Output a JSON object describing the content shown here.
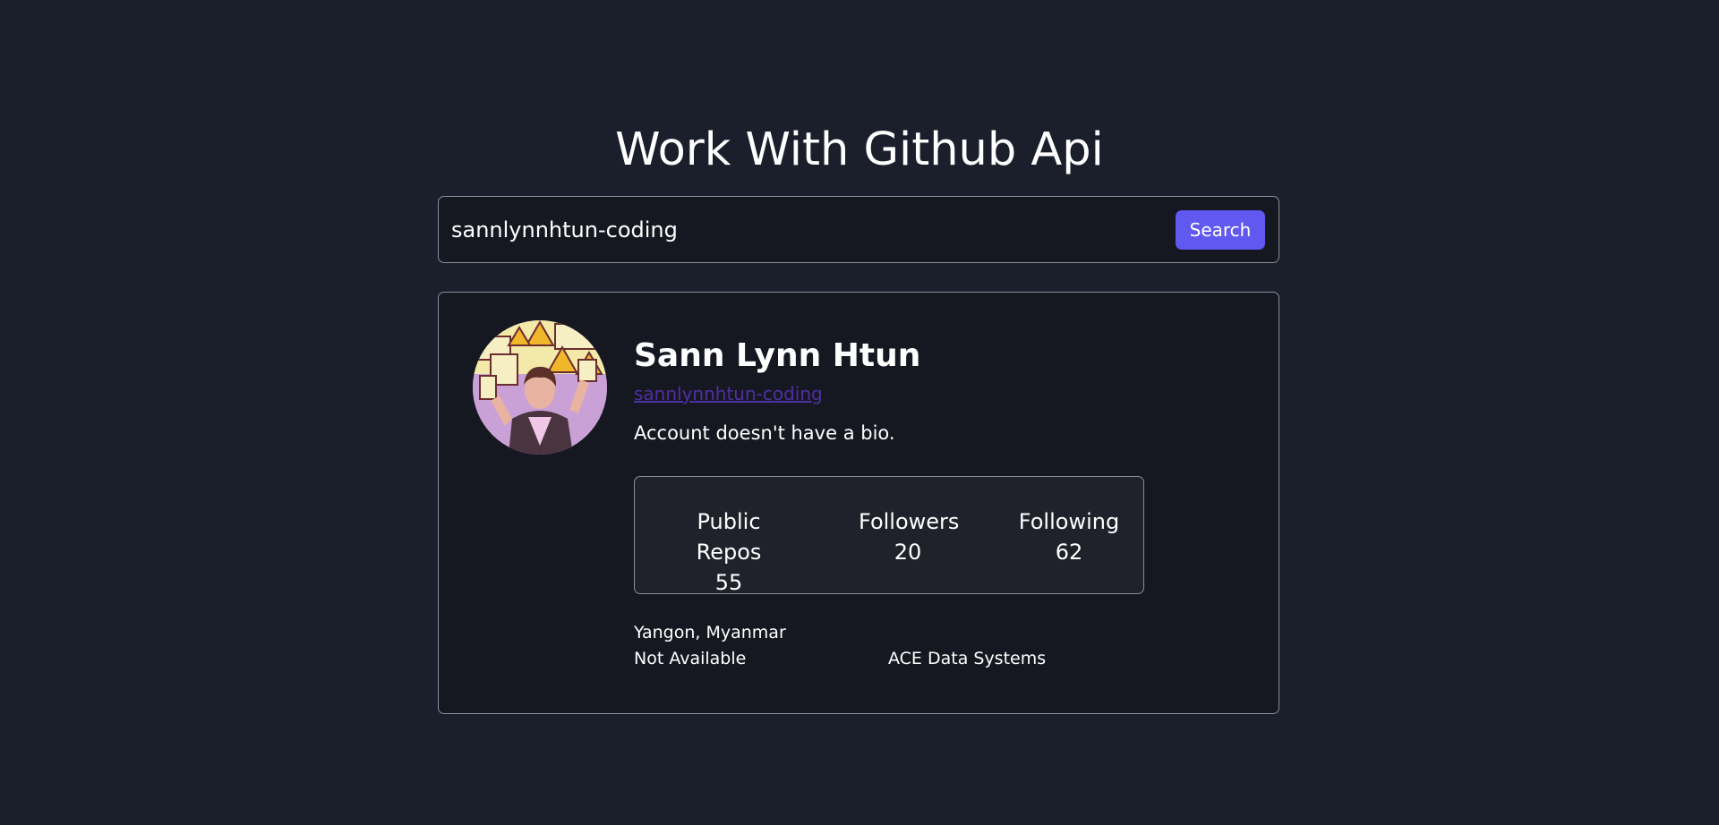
{
  "page": {
    "title": "Work With Github Api"
  },
  "search": {
    "value": "sannlynnhtun-coding",
    "button_label": "Search"
  },
  "profile": {
    "name": "Sann Lynn Htun",
    "login": "sannlynnhtun-coding",
    "bio": "Account doesn't have a bio.",
    "stats": {
      "repos_label": "Public Repos",
      "repos_value": "55",
      "followers_label": "Followers",
      "followers_value": "20",
      "following_label": "Following",
      "following_value": "62"
    },
    "location": "Yangon, Myanmar",
    "blog": "Not Available",
    "company": "ACE Data Systems"
  },
  "colors": {
    "background": "#1b1f2b",
    "card": "#161821",
    "accent": "#6158f0",
    "link": "#4f2fa3"
  }
}
